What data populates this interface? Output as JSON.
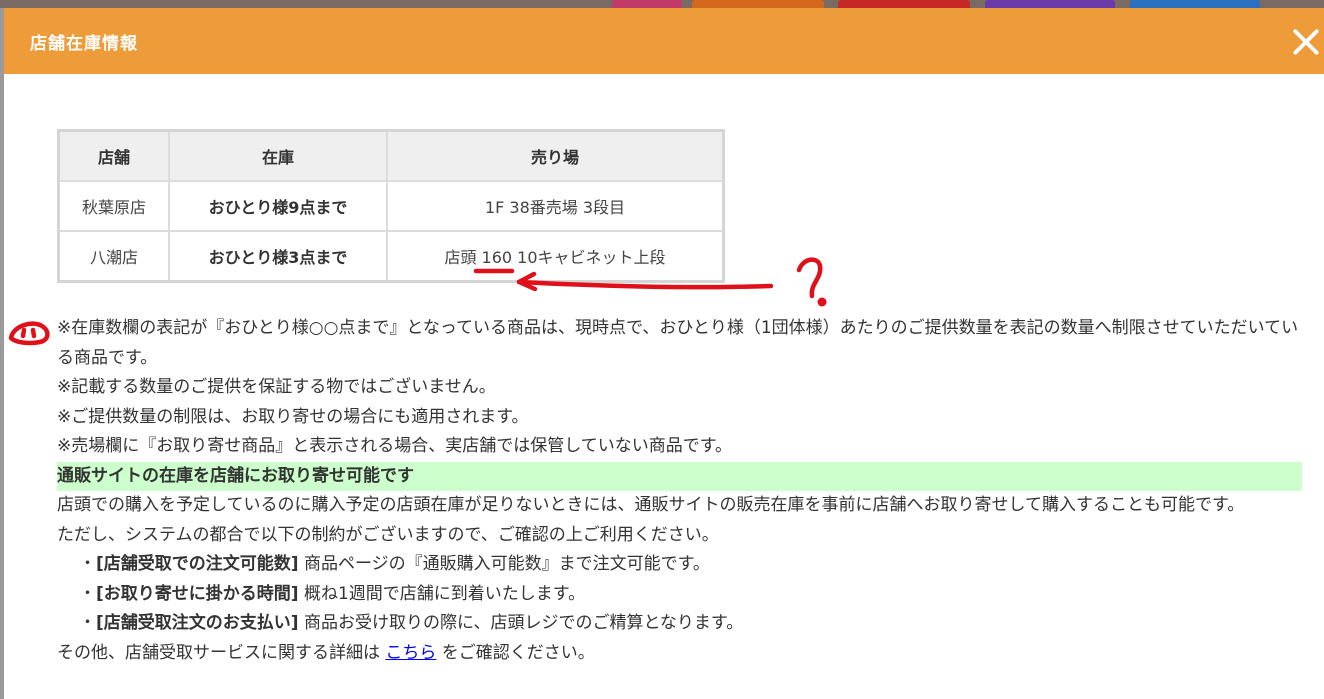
{
  "modal": {
    "title": "店舗在庫情報",
    "close_icon": "close-icon"
  },
  "table": {
    "headers": [
      "店舗",
      "在庫",
      "売り場"
    ],
    "rows": [
      {
        "store": "秋葉原店",
        "stock": "おひとり様9点まで",
        "location": "1F 38番売場 3段目"
      },
      {
        "store": "八潮店",
        "stock": "おひとり様3点まで",
        "location": "店頭 160 10キャビネット上段"
      }
    ]
  },
  "notes": {
    "line1": "※在庫数欄の表記が『おひとり様○○点まで』となっている商品は、現時点で、おひとり様（1団体様）あたりのご提供数量を表記の数量へ制限させていただいている商品です。",
    "line2": "※記載する数量のご提供を保証する物ではございません。",
    "line3": "※ご提供数量の制限は、お取り寄せの場合にも適用されます。",
    "line4": "※売場欄に『お取り寄せ商品』と表示される場合、実店舗では保管していない商品です。",
    "heading": "通販サイトの在庫を店舗にお取り寄せ可能です",
    "para1": "店頭での購入を予定しているのに購入予定の店頭在庫が足りないときには、通販サイトの販売在庫を事前に店舗へお取り寄せして購入することも可能です。",
    "para2": "ただし、システムの都合で以下の制約がございますので、ご確認の上ご利用ください。",
    "items": [
      {
        "label": "[店舗受取での注文可能数]",
        "text": "商品ページの『通販購入可能数』まで注文可能です。"
      },
      {
        "label": "[お取り寄せに掛かる時間]",
        "text": "概ね1週間で店舗に到着いたします。"
      },
      {
        "label": "[店舗受取注文のお支払い]",
        "text": "商品お受け取りの際に、店頭レジでのご精算となります。"
      }
    ],
    "bullet": "・",
    "footer_prefix": "その他、店舗受取サービスに関する詳細は ",
    "footer_link": "こちら",
    "footer_suffix": " をご確認ください。"
  },
  "colors": {
    "header": "#ee9c3a",
    "highlight": "#ccffcc",
    "annotation": "#e0101a",
    "link": "#0000ee"
  }
}
